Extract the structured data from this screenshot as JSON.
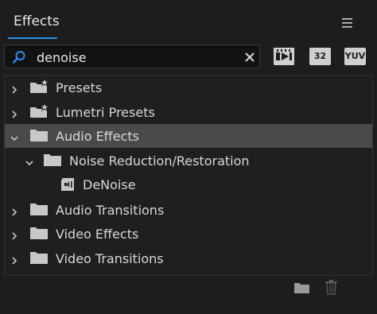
{
  "panel": {
    "title": "Effects",
    "menu_icon": "hamburger-menu-icon"
  },
  "search": {
    "value": "denoise",
    "icon": "search-icon",
    "clear_icon": "close-icon"
  },
  "filters": {
    "accelerated": {
      "icon": "accelerated-effects-icon"
    },
    "bit32": {
      "label": "32"
    },
    "yuv": {
      "label": "YUV"
    }
  },
  "tree": {
    "items": [
      {
        "label": "Presets",
        "icon": "starred-folder-icon",
        "expanded": false,
        "level": 0
      },
      {
        "label": "Lumetri Presets",
        "icon": "starred-folder-icon",
        "expanded": false,
        "level": 0
      },
      {
        "label": "Audio Effects",
        "icon": "folder-icon",
        "expanded": true,
        "level": 0,
        "selected": true
      },
      {
        "label": "Noise Reduction/Restoration",
        "icon": "folder-icon",
        "expanded": true,
        "level": 1
      },
      {
        "label": "DeNoise",
        "icon": "audio-effect-icon",
        "level": 2
      },
      {
        "label": "Audio Transitions",
        "icon": "folder-icon",
        "expanded": false,
        "level": 0
      },
      {
        "label": "Video Effects",
        "icon": "folder-icon",
        "expanded": false,
        "level": 0
      },
      {
        "label": "Video Transitions",
        "icon": "folder-icon",
        "expanded": false,
        "level": 0
      }
    ]
  },
  "footer": {
    "new_bin_icon": "new-folder-icon",
    "delete_icon": "trash-icon"
  },
  "colors": {
    "accent": "#2d8ceb",
    "selected_row": "#4a4a4a",
    "background": "#1d1d1d"
  }
}
